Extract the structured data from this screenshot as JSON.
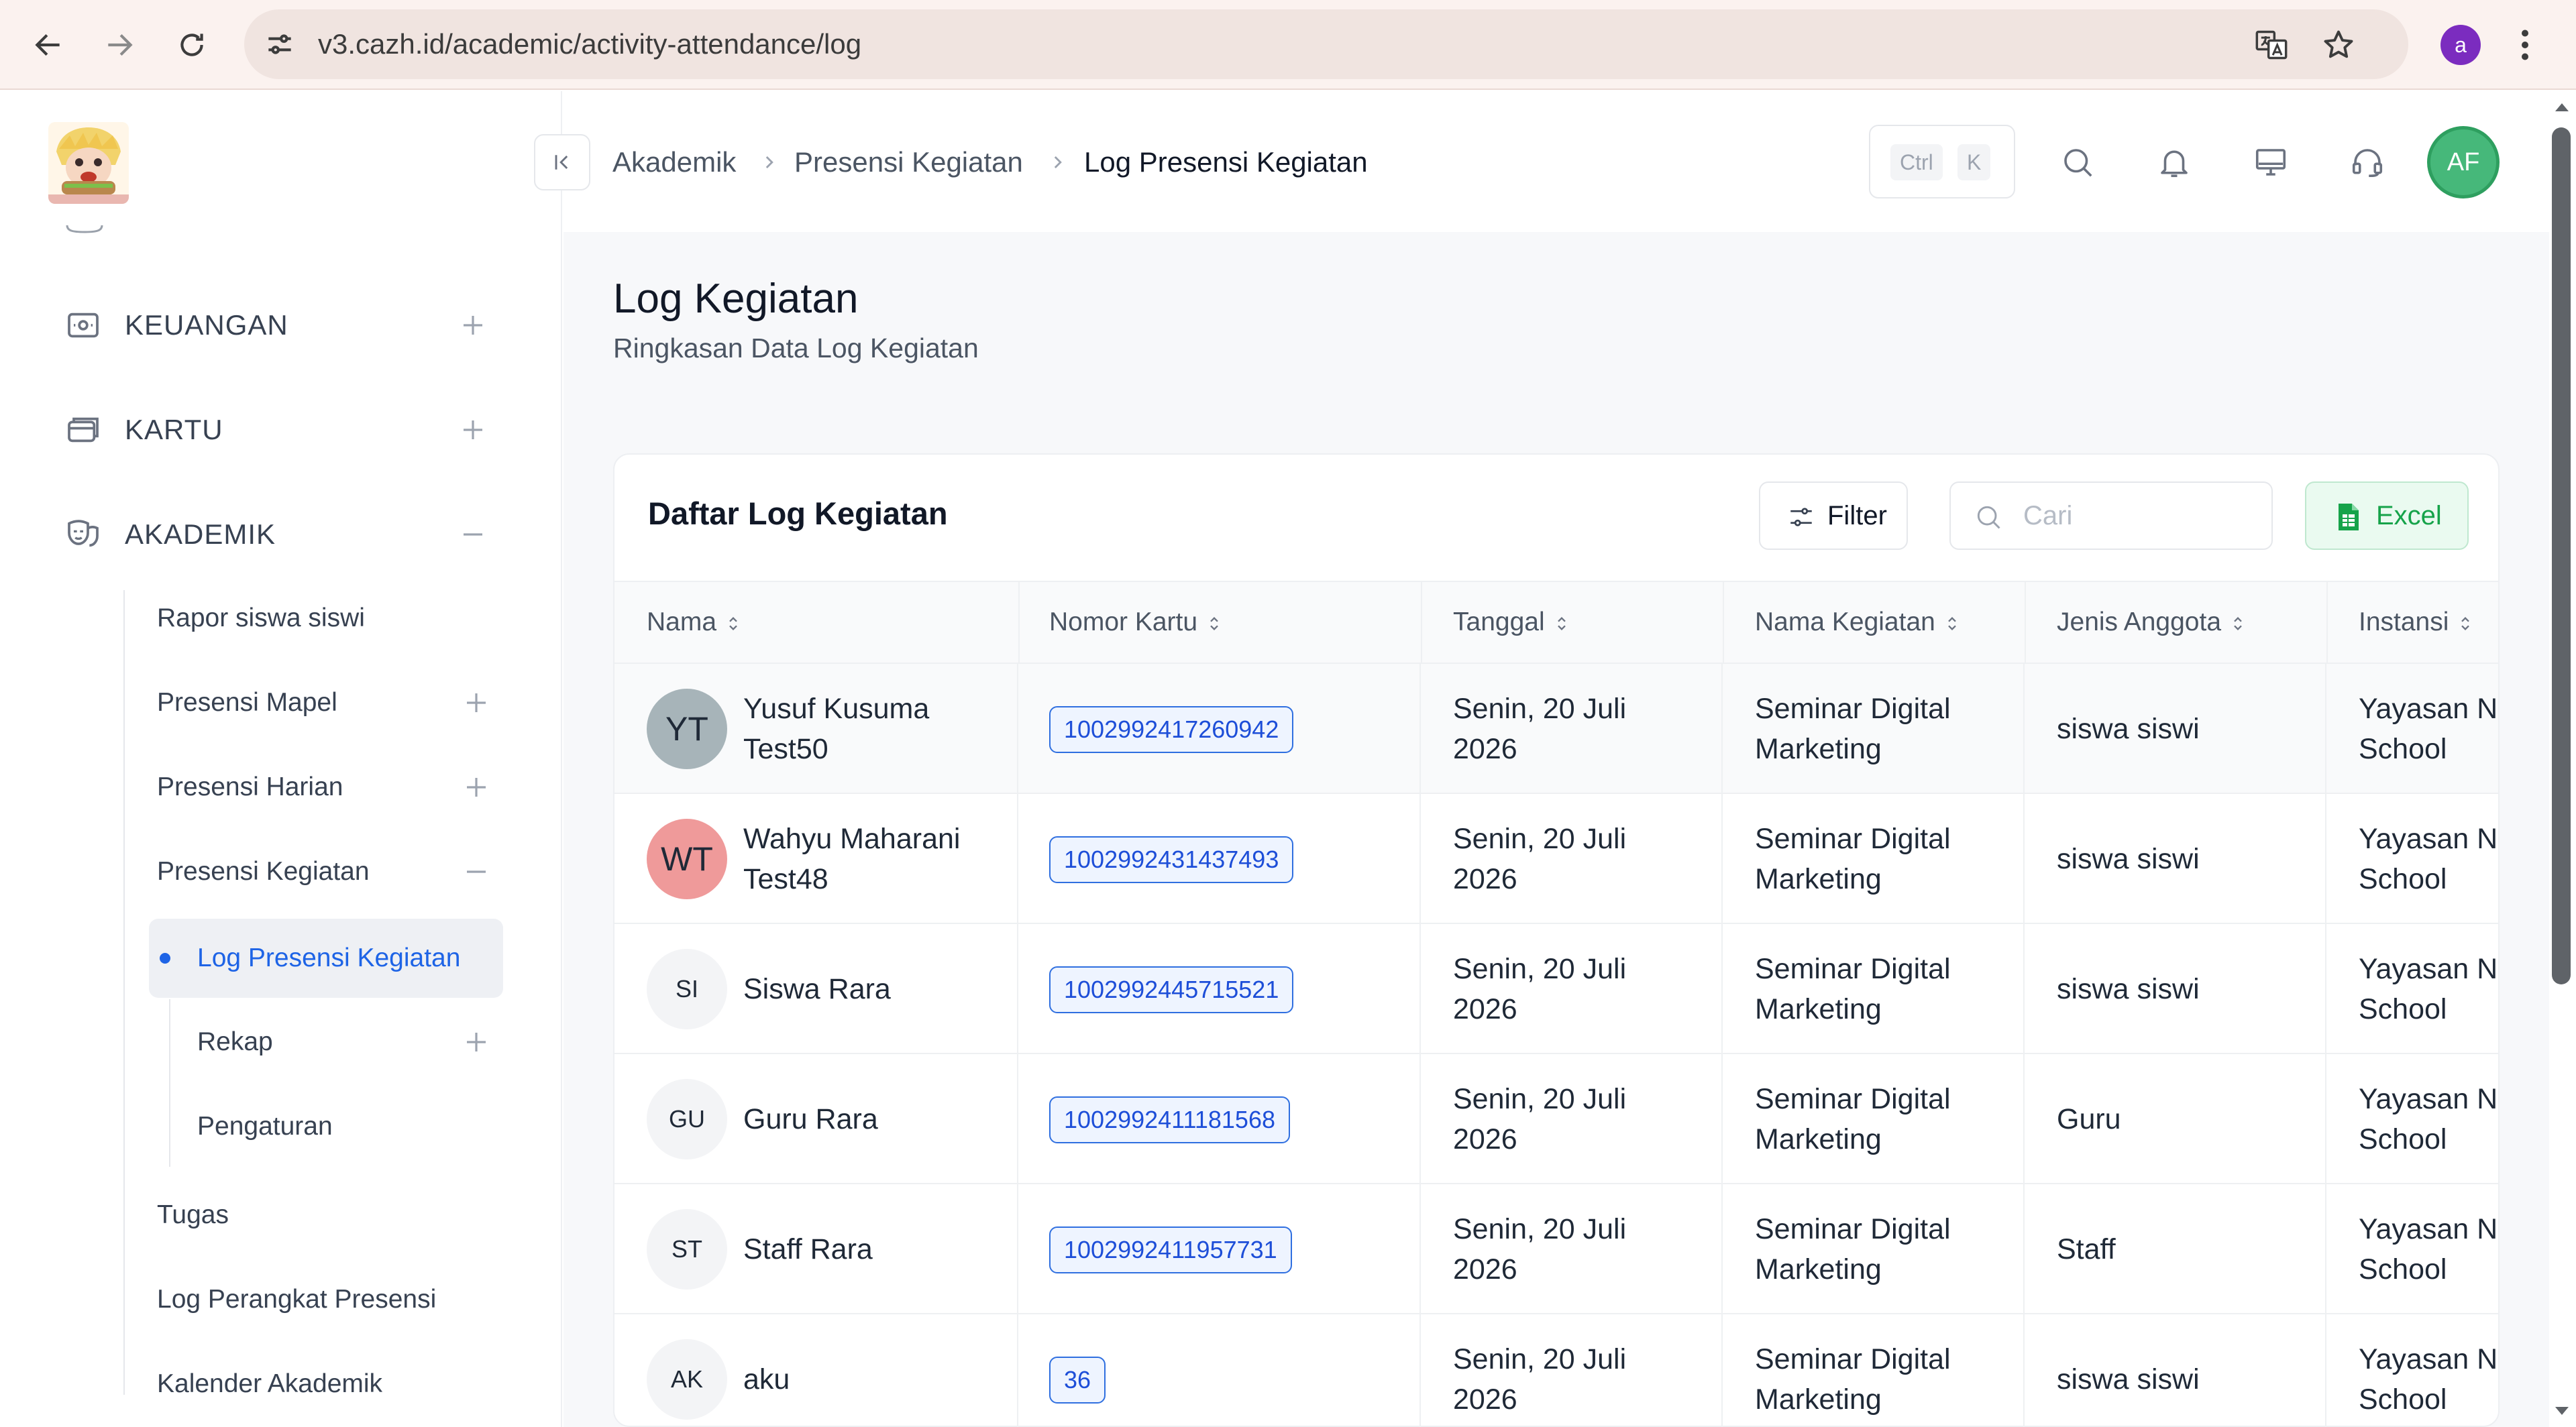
{
  "browser": {
    "url": "v3.cazh.id/academic/activity-attendance/log",
    "profile_initial": "a",
    "icons": [
      "back-arrow-icon",
      "forward-arrow-icon",
      "reload-icon",
      "site-settings-icon",
      "translate-icon",
      "star-icon",
      "kebab-menu-icon"
    ]
  },
  "sidebar": {
    "top_items": [
      {
        "label": "KEUANGAN",
        "icon": "wallet-icon",
        "state": "collapsed"
      },
      {
        "label": "KARTU",
        "icon": "card-icon",
        "state": "collapsed"
      },
      {
        "label": "AKADEMIK",
        "icon": "masks-icon",
        "state": "expanded"
      }
    ],
    "akademik_items": [
      {
        "label": "Rapor siswa siswi"
      },
      {
        "label": "Presensi Mapel",
        "state": "collapsed"
      },
      {
        "label": "Presensi Harian",
        "state": "collapsed"
      },
      {
        "label": "Presensi Kegiatan",
        "state": "expanded"
      },
      {
        "label": "Tugas"
      },
      {
        "label": "Log Perangkat Presensi"
      },
      {
        "label": "Kalender Akademik"
      }
    ],
    "kegiatan_items": [
      {
        "label": "Log Presensi Kegiatan",
        "active": true
      },
      {
        "label": "Rekap",
        "state": "collapsed"
      },
      {
        "label": "Pengaturan"
      }
    ],
    "active_color": "#1e64e6"
  },
  "header": {
    "breadcrumb": [
      "Akademik",
      "Presensi Kegiatan",
      "Log Presensi Kegiatan"
    ],
    "shortcut_keys": [
      "Ctrl",
      "K"
    ],
    "user_initials": "AF",
    "icons": [
      "collapse-sidebar-icon",
      "search-icon",
      "bell-icon",
      "monitor-icon",
      "headset-icon"
    ]
  },
  "page": {
    "title": "Log Kegiatan",
    "subtitle": "Ringkasan Data Log Kegiatan"
  },
  "table_card": {
    "title": "Daftar Log Kegiatan",
    "filter_label": "Filter",
    "search_placeholder": "Cari",
    "search_value": "",
    "export_label": "Excel",
    "columns": [
      "Nama",
      "Nomor Kartu",
      "Tanggal",
      "Nama Kegiatan",
      "Jenis Anggota",
      "Instansi"
    ],
    "rows": [
      {
        "initials": "YT",
        "name_line1": "Yusuf Kusuma",
        "name_line2": "Test50",
        "card": "1002992417260942",
        "date_line1": "Senin, 20 Juli",
        "date_line2": "2026",
        "activity_line1": "Seminar Digital",
        "activity_line2": "Marketing",
        "member_type": "siswa siswi",
        "inst_line1": "Yayasan N",
        "inst_line2": "School",
        "avatar_color": "#a7b4b9"
      },
      {
        "initials": "WT",
        "name_line1": "Wahyu Maharani",
        "name_line2": "Test48",
        "card": "1002992431437493",
        "date_line1": "Senin, 20 Juli",
        "date_line2": "2026",
        "activity_line1": "Seminar Digital",
        "activity_line2": "Marketing",
        "member_type": "siswa siswi",
        "inst_line1": "Yayasan N",
        "inst_line2": "School",
        "avatar_color": "#ef9a9a"
      },
      {
        "initials": "SI",
        "name_line1": "Siswa Rara",
        "name_line2": "",
        "card": "1002992445715521",
        "date_line1": "Senin, 20 Juli",
        "date_line2": "2026",
        "activity_line1": "Seminar Digital",
        "activity_line2": "Marketing",
        "member_type": "siswa siswi",
        "inst_line1": "Yayasan N",
        "inst_line2": "School",
        "avatar_color": "#f3f4f6"
      },
      {
        "initials": "GU",
        "name_line1": "Guru Rara",
        "name_line2": "",
        "card": "1002992411181568",
        "date_line1": "Senin, 20 Juli",
        "date_line2": "2026",
        "activity_line1": "Seminar Digital",
        "activity_line2": "Marketing",
        "member_type": "Guru",
        "inst_line1": "Yayasan N",
        "inst_line2": "School",
        "avatar_color": "#f3f4f6"
      },
      {
        "initials": "ST",
        "name_line1": "Staff Rara",
        "name_line2": "",
        "card": "1002992411957731",
        "date_line1": "Senin, 20 Juli",
        "date_line2": "2026",
        "activity_line1": "Seminar Digital",
        "activity_line2": "Marketing",
        "member_type": "Staff",
        "inst_line1": "Yayasan N",
        "inst_line2": "School",
        "avatar_color": "#f3f4f6"
      },
      {
        "initials": "AK",
        "name_line1": "aku",
        "name_line2": "",
        "card": "36",
        "date_line1": "Senin, 20 Juli",
        "date_line2": "2026",
        "activity_line1": "Seminar Digital",
        "activity_line2": "Marketing",
        "member_type": "siswa siswi",
        "inst_line1": "Yayasan N",
        "inst_line2": "School",
        "avatar_color": "#f3f4f6"
      }
    ]
  }
}
